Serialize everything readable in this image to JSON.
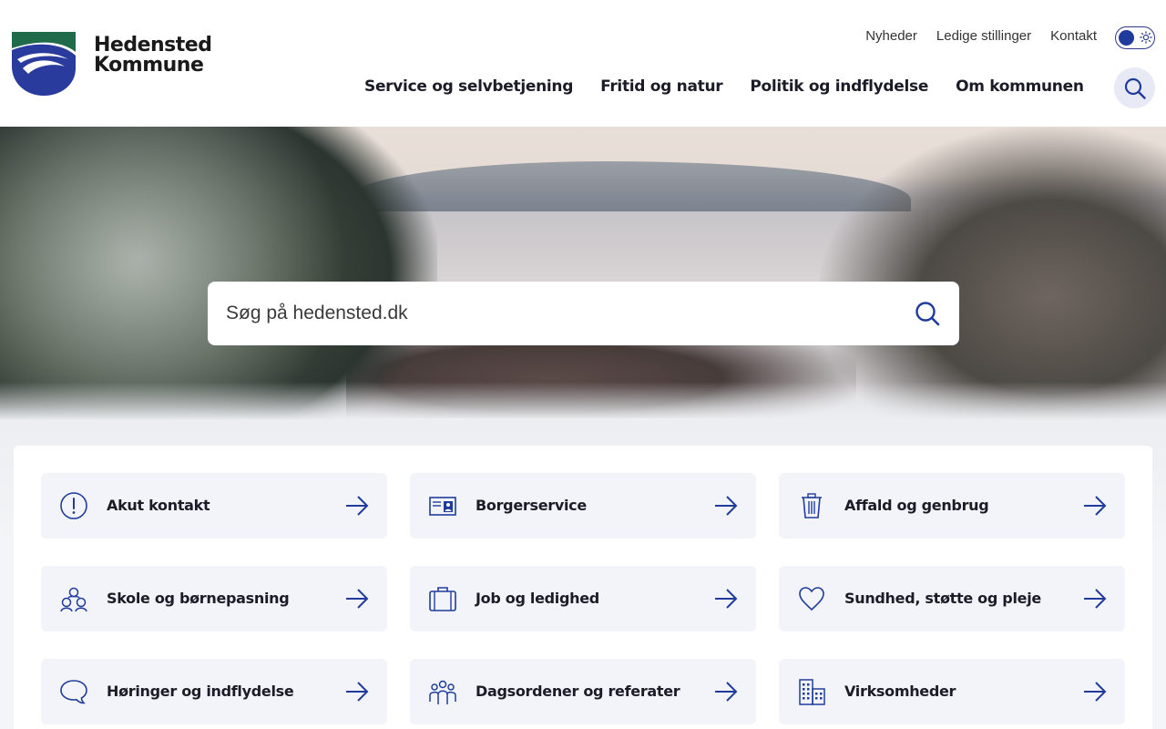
{
  "brand": {
    "name_line1": "Hedensted",
    "name_line2": "Kommune",
    "colors": {
      "green": "#1f6b4a",
      "blue": "#2a3b9e",
      "accent": "#1f3c9c"
    }
  },
  "util_nav": [
    {
      "label": "Nyheder"
    },
    {
      "label": "Ledige stillinger"
    },
    {
      "label": "Kontakt"
    }
  ],
  "theme_toggle": {
    "state": "light",
    "icon": "sun-icon"
  },
  "main_nav": [
    {
      "label": "Service og selvbetjening"
    },
    {
      "label": "Fritid og natur"
    },
    {
      "label": "Politik og indflydelse"
    },
    {
      "label": "Om kommunen"
    }
  ],
  "hero": {
    "search_placeholder": "Søg på hedensted.dk"
  },
  "tiles": [
    {
      "label": "Akut kontakt",
      "icon": "exclamation-icon"
    },
    {
      "label": "Borgerservice",
      "icon": "id-card-icon"
    },
    {
      "label": "Affald og genbrug",
      "icon": "trash-icon"
    },
    {
      "label": "Skole og børnepasning",
      "icon": "children-icon"
    },
    {
      "label": "Job og ledighed",
      "icon": "briefcase-icon"
    },
    {
      "label": "Sundhed, støtte og pleje",
      "icon": "heart-icon"
    },
    {
      "label": "Høringer og indflydelse",
      "icon": "speech-bubble-icon"
    },
    {
      "label": "Dagsordener og referater",
      "icon": "people-group-icon"
    },
    {
      "label": "Virksomheder",
      "icon": "buildings-icon"
    }
  ]
}
